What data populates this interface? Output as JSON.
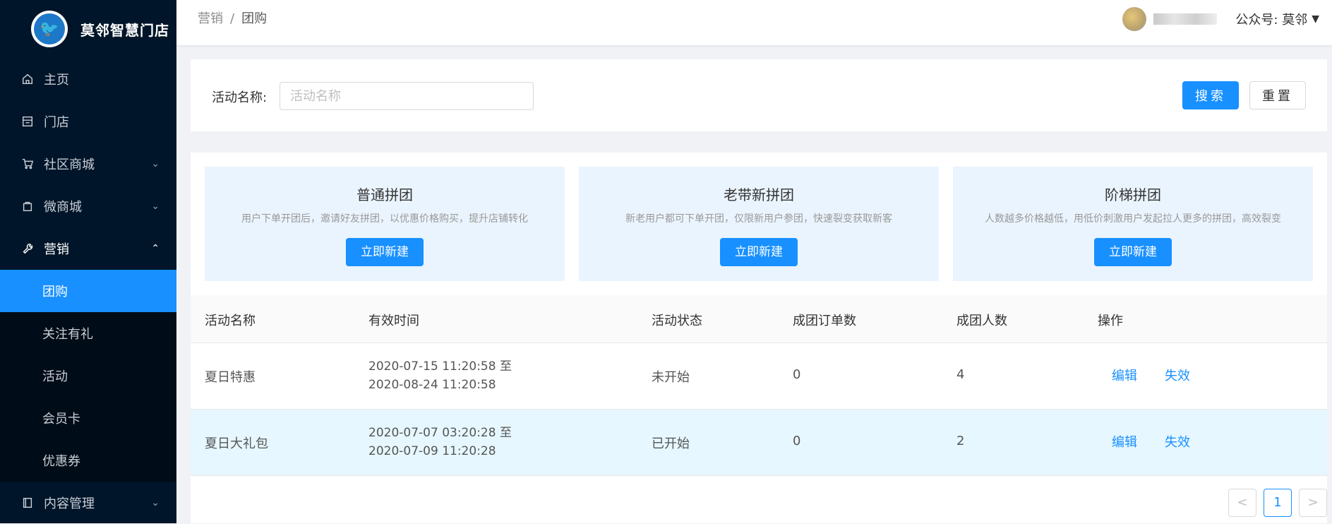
{
  "app": {
    "name": "莫邻智慧门店"
  },
  "sidebar": {
    "items": [
      {
        "label": "主页",
        "icon": "home-icon"
      },
      {
        "label": "门店",
        "icon": "store-icon"
      },
      {
        "label": "社区商城",
        "icon": "cart-icon"
      },
      {
        "label": "微商城",
        "icon": "bag-icon"
      },
      {
        "label": "营销",
        "icon": "wrench-icon"
      },
      {
        "label": "内容管理",
        "icon": "book-icon"
      }
    ],
    "marketing_sub": [
      "团购",
      "关注有礼",
      "活动",
      "会员卡",
      "优惠券"
    ]
  },
  "header": {
    "breadcrumb": [
      "营销",
      "团购"
    ],
    "account_label": "公众号: 莫邻"
  },
  "search": {
    "label": "活动名称:",
    "placeholder": "活动名称",
    "value": "",
    "search_btn": "搜索",
    "reset_btn": "重置"
  },
  "cards": [
    {
      "title": "普通拼团",
      "desc": "用户下单开团后，邀请好友拼团，以优惠价格购买，提升店铺转化",
      "btn": "立即新建"
    },
    {
      "title": "老带新拼团",
      "desc": "新老用户都可下单开团，仅限新用户参团，快速裂变获取新客",
      "btn": "立即新建"
    },
    {
      "title": "阶梯拼团",
      "desc": "人数越多价格越低，用低价刺激用户发起拉人更多的拼团，高效裂变",
      "btn": "立即新建"
    }
  ],
  "table": {
    "columns": [
      "活动名称",
      "有效时间",
      "活动状态",
      "成团订单数",
      "成团人数",
      "操作"
    ],
    "rows": [
      {
        "name": "夏日特惠",
        "time_start": "2020-07-15 11:20:58 至",
        "time_end": "2020-08-24 11:20:58",
        "status": "未开始",
        "orders": "0",
        "people": "4",
        "edit": "编辑",
        "disable": "失效"
      },
      {
        "name": "夏日大礼包",
        "time_start": "2020-07-07 03:20:28 至",
        "time_end": "2020-07-09 11:20:28",
        "status": "已开始",
        "orders": "0",
        "people": "2",
        "edit": "编辑",
        "disable": "失效"
      }
    ]
  },
  "pagination": {
    "prev": "<",
    "page": "1",
    "next": ">"
  }
}
